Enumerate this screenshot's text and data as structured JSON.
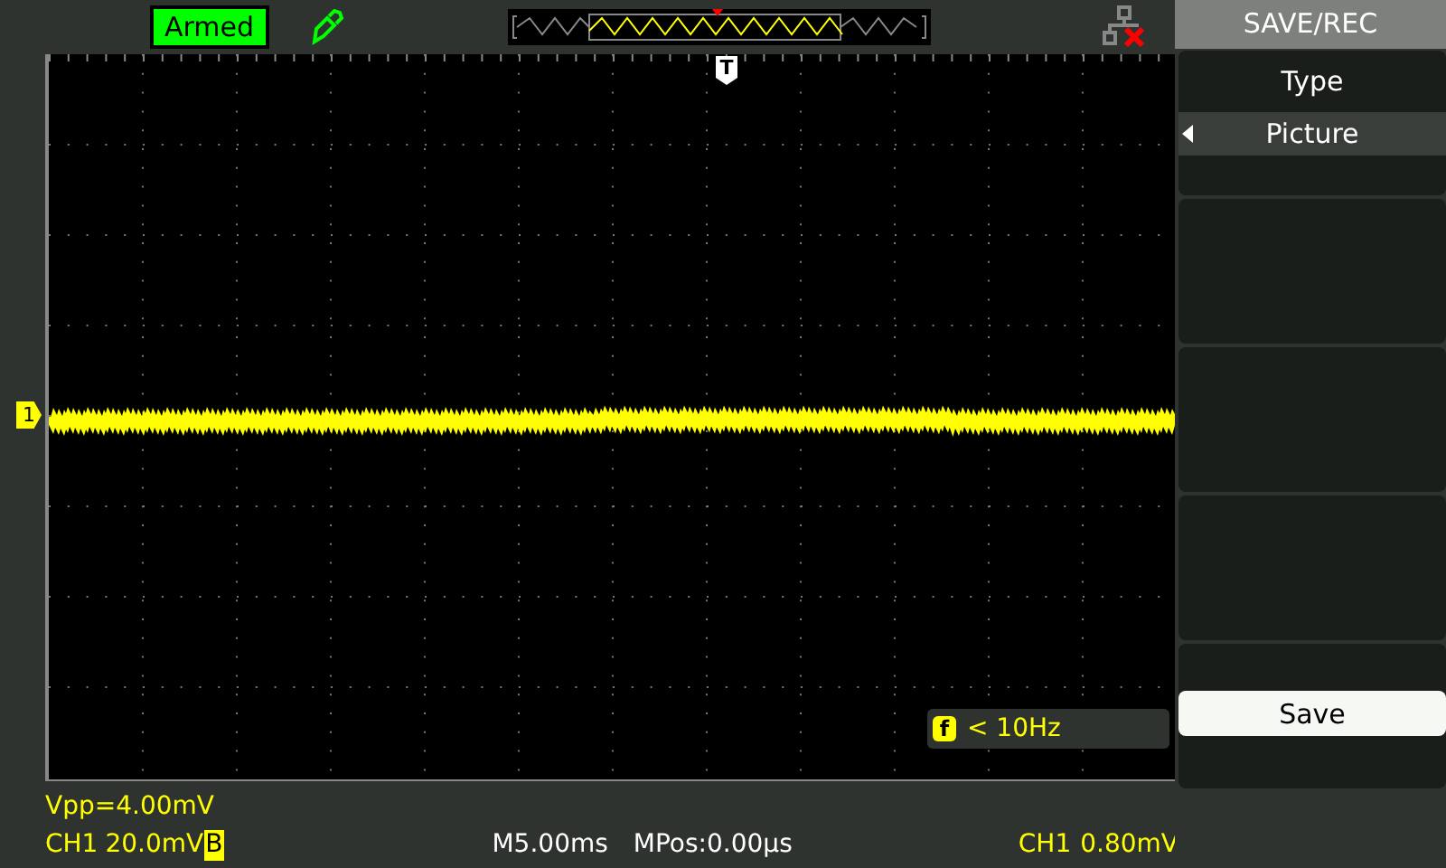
{
  "status": {
    "label": "Armed"
  },
  "trigger_marker": "T",
  "channel_marker": "1",
  "frequency": {
    "badge": "f",
    "reading": "< 10Hz"
  },
  "measurement": "Vpp=4.00mV",
  "channel": {
    "name": "CH1",
    "scale": "20.0mV",
    "bandwidth_limit": "B"
  },
  "timebase": "M5.00ms",
  "position": "MPos:0.00µs",
  "trigger": {
    "source": "CH1",
    "level": "0.80mV"
  },
  "menu": {
    "title": "SAVE/REC",
    "items": [
      {
        "kind": "option",
        "label": "Type",
        "value": "Picture"
      },
      {
        "kind": "blank"
      },
      {
        "kind": "blank"
      },
      {
        "kind": "blank"
      },
      {
        "kind": "action",
        "label": "Save"
      }
    ]
  }
}
